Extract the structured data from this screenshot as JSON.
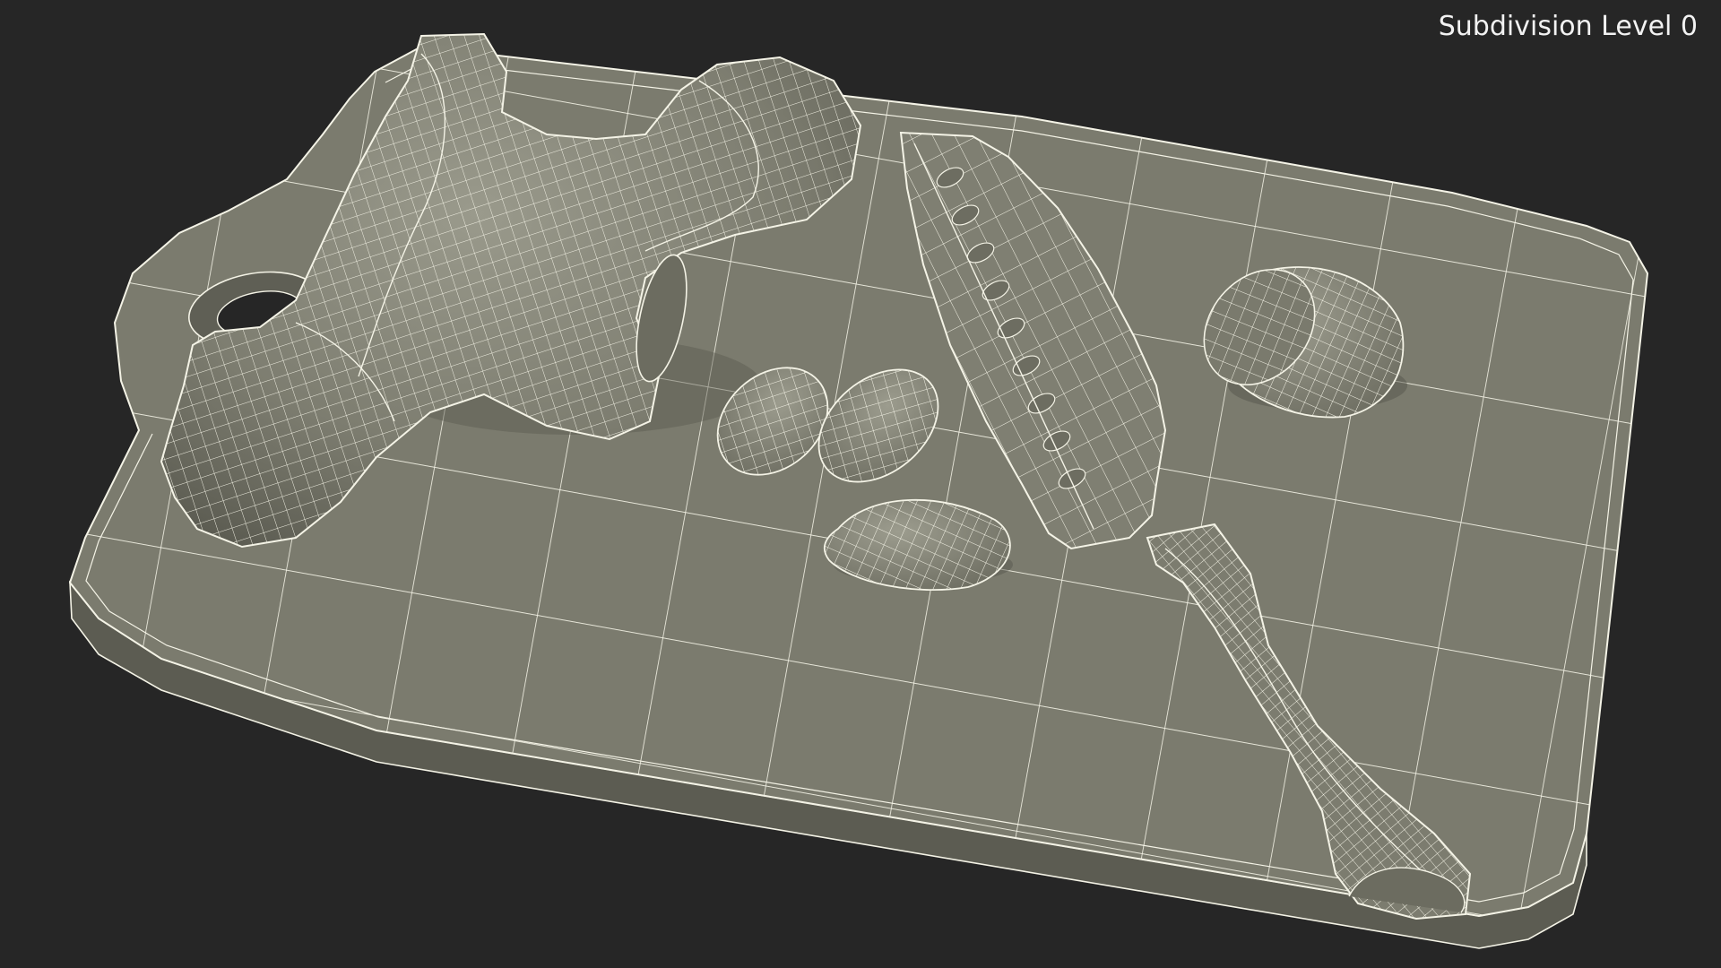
{
  "viewport": {
    "label": "Subdivision Level 0"
  },
  "scene": {
    "objects": [
      "cutting-board",
      "ginger-root",
      "ginger-slice",
      "ginger-slice",
      "ginger-slice",
      "ginger-piece",
      "santoku-knife"
    ],
    "render_mode": "wireframe-on-shaded"
  },
  "colors": {
    "background": "#262626",
    "surface": "#7a7a6c",
    "surface_light": "#8b8b7d",
    "surface_dark": "#5e5e53",
    "wire": "#f4f3e6"
  }
}
